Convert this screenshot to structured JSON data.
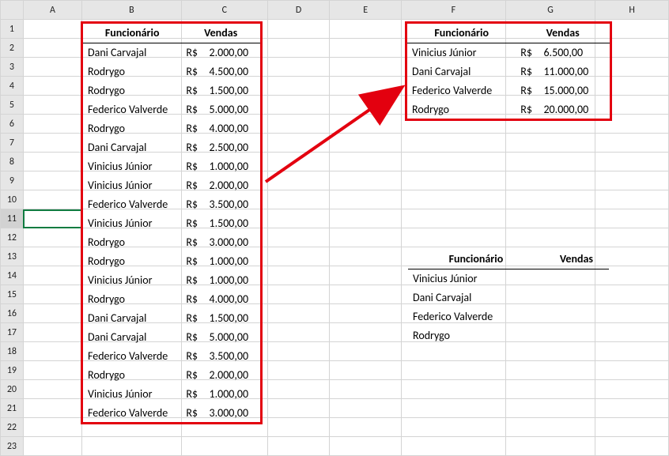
{
  "columns": [
    "A",
    "B",
    "C",
    "D",
    "E",
    "F",
    "G",
    "H"
  ],
  "rows": [
    "1",
    "2",
    "3",
    "4",
    "5",
    "6",
    "7",
    "8",
    "9",
    "10",
    "11",
    "12",
    "13",
    "14",
    "15",
    "16",
    "17",
    "18",
    "19",
    "20",
    "21",
    "22",
    "23"
  ],
  "selected_row": 11,
  "annotation_color": "#e3000f",
  "main_table": {
    "headers": {
      "func": "Funcionário",
      "vendas": "Vendas"
    },
    "currency": "R$",
    "rows": [
      {
        "name": "Dani Carvajal",
        "value": "2.000,00"
      },
      {
        "name": "Rodrygo",
        "value": "4.500,00"
      },
      {
        "name": "Rodrygo",
        "value": "1.500,00"
      },
      {
        "name": "Federico Valverde",
        "value": "5.000,00"
      },
      {
        "name": "Rodrygo",
        "value": "4.000,00"
      },
      {
        "name": "Dani Carvajal",
        "value": "2.500,00"
      },
      {
        "name": "Vinicius Júnior",
        "value": "1.000,00"
      },
      {
        "name": "Vinicius Júnior",
        "value": "2.000,00"
      },
      {
        "name": "Federico Valverde",
        "value": "3.500,00"
      },
      {
        "name": "Vinicius Júnior",
        "value": "1.500,00"
      },
      {
        "name": "Rodrygo",
        "value": "3.000,00"
      },
      {
        "name": "Rodrygo",
        "value": "1.000,00"
      },
      {
        "name": "Vinicius Júnior",
        "value": "1.000,00"
      },
      {
        "name": "Rodrygo",
        "value": "4.000,00"
      },
      {
        "name": "Dani Carvajal",
        "value": "1.500,00"
      },
      {
        "name": "Dani Carvajal",
        "value": "5.000,00"
      },
      {
        "name": "Federico Valverde",
        "value": "3.500,00"
      },
      {
        "name": "Rodrygo",
        "value": "2.000,00"
      },
      {
        "name": "Vinicius Júnior",
        "value": "1.000,00"
      },
      {
        "name": "Federico Valverde",
        "value": "3.000,00"
      }
    ]
  },
  "summary_table": {
    "headers": {
      "func": "Funcionário",
      "vendas": "Vendas"
    },
    "currency": "R$",
    "rows": [
      {
        "name": "Vinicius Júnior",
        "value": "6.500,00"
      },
      {
        "name": "Dani Carvajal",
        "value": "11.000,00"
      },
      {
        "name": "Federico Valverde",
        "value": "15.000,00"
      },
      {
        "name": "Rodrygo",
        "value": "20.000,00"
      }
    ]
  },
  "blank_table": {
    "headers": {
      "func": "Funcionário",
      "vendas": "Vendas"
    },
    "rows": [
      {
        "name": "Vinicius Júnior"
      },
      {
        "name": "Dani Carvajal"
      },
      {
        "name": "Federico Valverde"
      },
      {
        "name": "Rodrygo"
      }
    ]
  }
}
